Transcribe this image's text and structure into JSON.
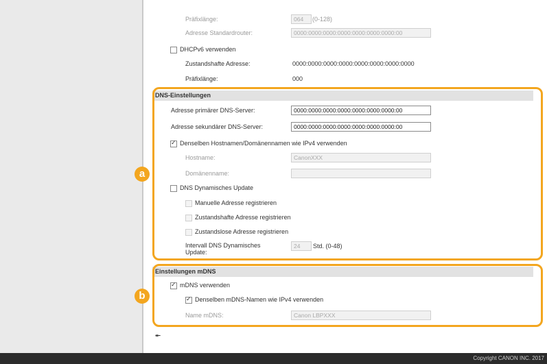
{
  "ipv6": {
    "prefix_length_label": "Präfixlänge:",
    "prefix_length_value": "064",
    "prefix_length_range": "(0-128)",
    "default_router_label": "Adresse Standardrouter:",
    "default_router_value": "0000:0000:0000:0000:0000:0000:0000:00",
    "dhcpv6_label": "DHCPv6 verwenden",
    "stateful_address_label": "Zustandshafte Adresse:",
    "stateful_address_value": "0000:0000:0000:0000:0000:0000:0000:0000",
    "prefix_length2_label": "Präfixlänge:",
    "prefix_length2_value": "000"
  },
  "dns": {
    "title": "DNS-Einstellungen",
    "primary_label": "Adresse primärer DNS-Server:",
    "primary_value": "0000:0000:0000:0000:0000:0000:0000:00",
    "secondary_label": "Adresse sekundärer DNS-Server:",
    "secondary_value": "0000:0000:0000:0000:0000:0000:0000:00",
    "same_host_label": "Denselben Hostnamen/Domänennamen wie IPv4 verwenden",
    "hostname_label": "Hostname:",
    "hostname_value": "CanonXXX",
    "domain_label": "Domänenname:",
    "domain_value": "",
    "dynamic_update_label": "DNS Dynamisches Update",
    "manual_label": "Manuelle Adresse registrieren",
    "stateful_label": "Zustandshafte Adresse registrieren",
    "stateless_label": "Zustandslose Adresse registrieren",
    "interval_label": "Intervall DNS Dynamisches Update:",
    "interval_value": "24",
    "interval_unit": "Std. (0-48)"
  },
  "mdns": {
    "title": "Einstellungen mDNS",
    "use_label": "mDNS verwenden",
    "same_name_label": "Denselben mDNS-Namen wie IPv4 verwenden",
    "name_label": "Name mDNS:",
    "name_value": "Canon LBPXXX"
  },
  "callouts": {
    "a": "a",
    "b": "b"
  },
  "footer": {
    "top_link_glyph": "⯬",
    "copyright": "Copyright CANON INC. 2017"
  },
  "colors": {
    "accent": "#f3a61f",
    "footer_bg": "#2b2b2b"
  }
}
